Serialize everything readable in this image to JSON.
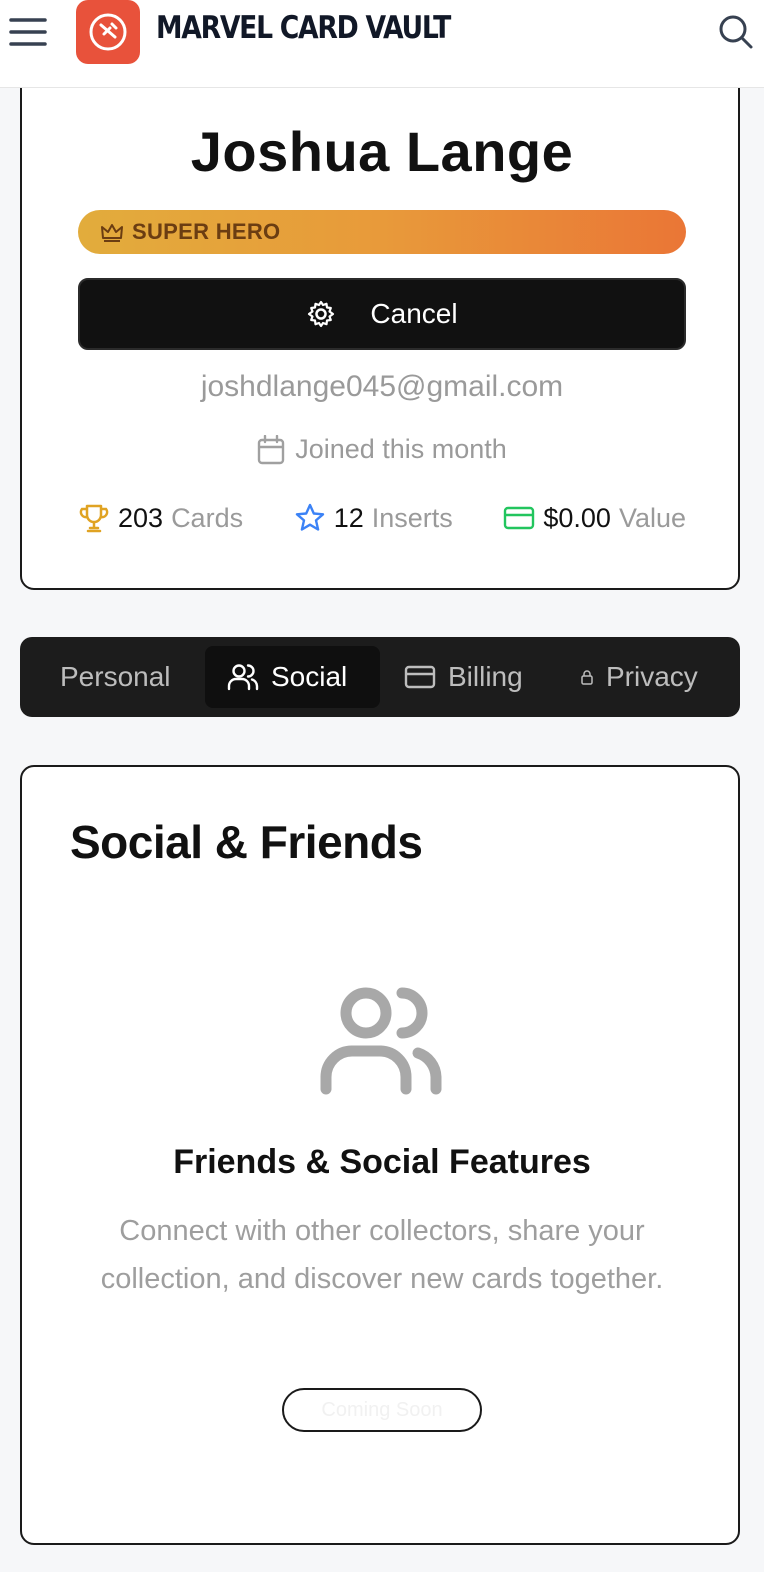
{
  "header": {
    "brand": "MARVEL CARD VAULT",
    "menu_icon": "hamburger-icon",
    "logo_icon": "hero-logo-icon",
    "search_icon": "search-icon",
    "logo_color": "#e8523b"
  },
  "profile": {
    "name": "Joshua Lange",
    "badge": "SUPER HERO",
    "badge_icon": "crown-icon",
    "action_button": "Cancel",
    "action_icon": "gear-icon",
    "email": "joshdlange045@gmail.com",
    "joined": "Joined this month",
    "joined_icon": "calendar-icon",
    "stats": [
      {
        "icon": "trophy-icon",
        "value": "203",
        "label": "Cards",
        "color": "#e0a323"
      },
      {
        "icon": "star-icon",
        "value": "12",
        "label": "Inserts",
        "color": "#3b82f6"
      },
      {
        "icon": "credit-card-icon",
        "value": "$0.00",
        "label": "Value",
        "color": "#22c55e"
      }
    ]
  },
  "tabs": [
    {
      "label": "Personal",
      "active": false
    },
    {
      "label": "Social",
      "icon": "users-icon",
      "active": true
    },
    {
      "label": "Billing",
      "icon": "credit-card-icon",
      "active": false
    },
    {
      "label": "Privacy",
      "icon": "lock-icon",
      "active": false
    }
  ],
  "social": {
    "title": "Social & Friends",
    "icon": "users-icon",
    "feature_title": "Friends & Social Features",
    "description": "Connect with other collectors, share your collection, and discover new cards together.",
    "button": "Coming Soon"
  }
}
